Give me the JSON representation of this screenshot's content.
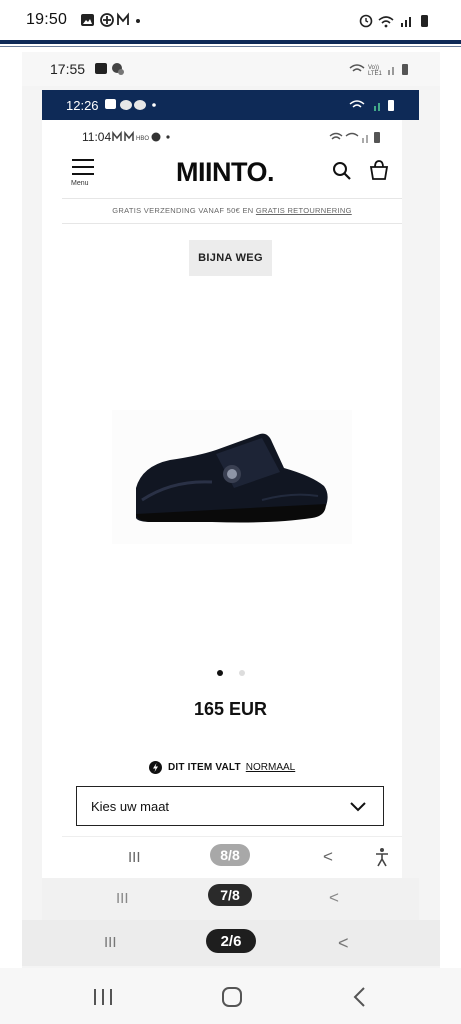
{
  "outer_status": {
    "time": "19:50",
    "icons": [
      "gallery-icon",
      "pinwheel-icon",
      "mail-icon",
      "dot-icon"
    ],
    "right_icons": [
      "alarm-icon",
      "wifi-icon",
      "signal-icon",
      "battery-icon"
    ]
  },
  "layer1_status": {
    "time": "17:55",
    "network": "Vo)) LTE1"
  },
  "layer2_status": {
    "time": "12:26"
  },
  "layer3_status": {
    "time": "11:04"
  },
  "header": {
    "menu_label": "Menu",
    "logo": "MIINTO."
  },
  "shipping": {
    "text": "GRATIS VERZENDING VANAF 50€ EN ",
    "link": "GRATIS RETOURNERING"
  },
  "product": {
    "badge": "BIJNA WEG",
    "image_alt": "Black velcro shoe",
    "carousel_dots": 2,
    "active_dot": 0,
    "price": "165 EUR",
    "fit_prefix": "DIT ITEM VALT",
    "fit_value": "NORMAAL",
    "size_placeholder": "Kies uw maat"
  },
  "navs": {
    "layer3_counter": "8/8",
    "layer2_counter": "7/8",
    "layer1_counter": "2/6",
    "recents_glyph": "III",
    "back_glyph": "<"
  },
  "colors": {
    "navy": "#0e2a57",
    "pill_dark": "#222222",
    "pill_light": "#a8a8a8"
  }
}
